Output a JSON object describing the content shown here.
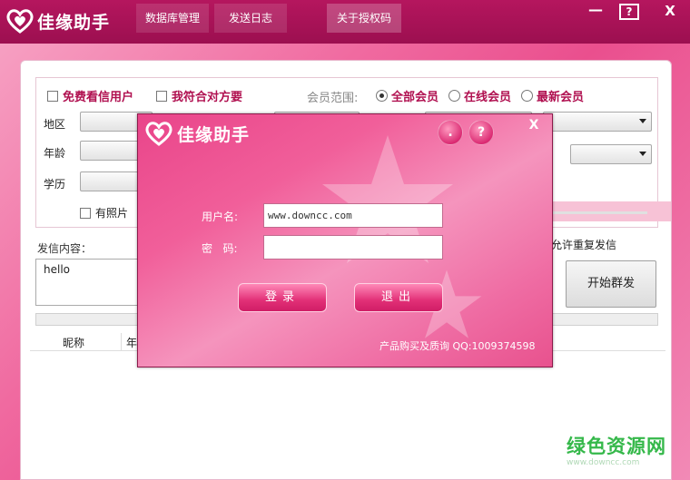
{
  "app": {
    "name": "佳缘助手"
  },
  "menu": [
    {
      "label": "数据库管理"
    },
    {
      "label": "发送日志"
    },
    {
      "label": "关于授权码"
    }
  ],
  "window_controls": {
    "minimize": "—",
    "help": "?",
    "close": "X"
  },
  "filters": {
    "free_users_label": "免费看信用户",
    "match_me_label": "我符合对方要",
    "member_range_label": "会员范围:",
    "radio_options": [
      {
        "label": "全部会员",
        "selected": true
      },
      {
        "label": "在线会员",
        "selected": false
      },
      {
        "label": "最新会员",
        "selected": false
      }
    ],
    "region_label": "地区",
    "age_label": "年龄",
    "education_label": "学历",
    "has_photo_label": "有照片",
    "allow_repeat_label": "允许重复发信"
  },
  "message": {
    "label": "发信内容：",
    "content": "hello"
  },
  "start_button": "开始群发",
  "table": {
    "columns": [
      "昵称",
      "年"
    ]
  },
  "dialog": {
    "title": "佳缘助手",
    "dot_button": ".",
    "help_button": "?",
    "close": "X",
    "username_label": "用户名:",
    "username_value": "www.downcc.com",
    "password_label": "密   码:",
    "password_value": "",
    "login_button": "登录",
    "exit_button": "退出",
    "footer": "产品购买及质询 QQ:1009374598"
  },
  "watermark": {
    "text": "绿色资源网",
    "sub": "www.downcc.com"
  },
  "colors": {
    "titlebar": "#a3124f",
    "accent": "#e23077",
    "checkbox_label": "#b01050",
    "watermark": "#35b84a"
  }
}
